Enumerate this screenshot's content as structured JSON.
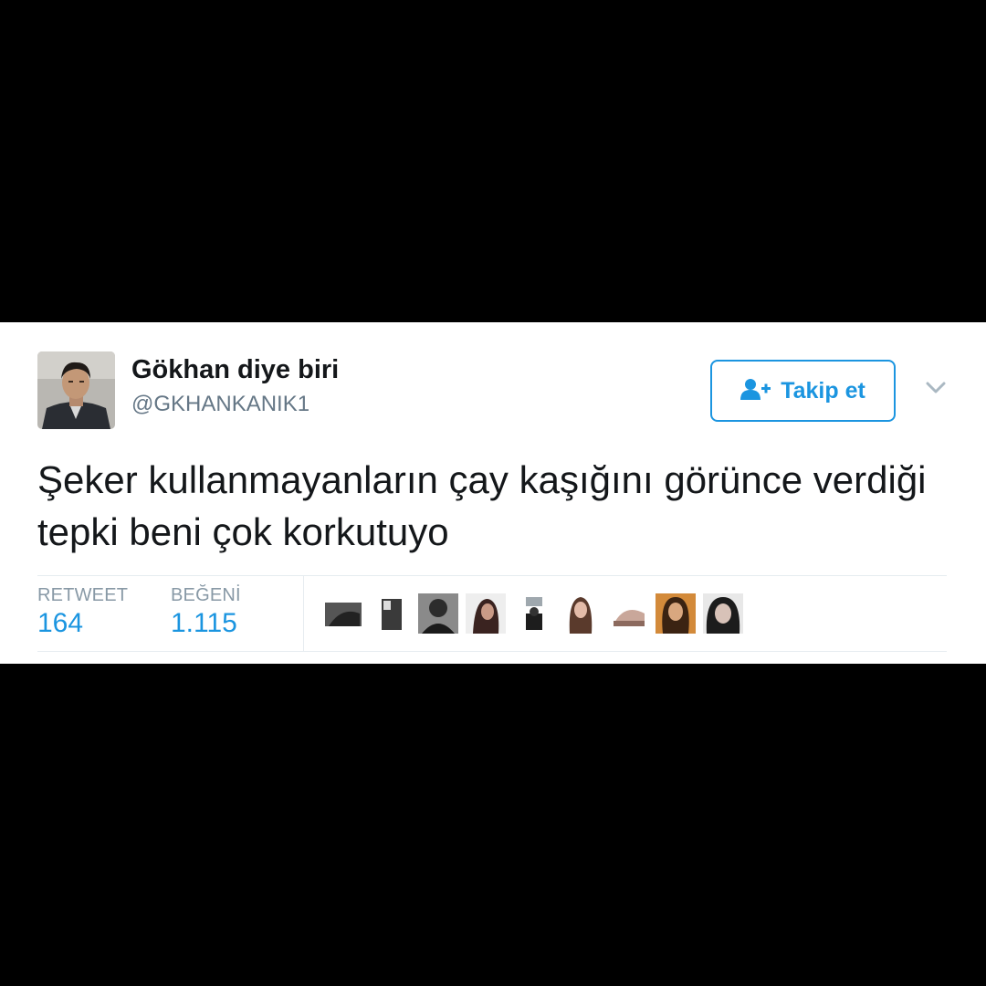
{
  "tweet": {
    "display_name": "Gökhan diye biri",
    "handle": "@GKHANKANIK1",
    "text": "Şeker kullanmayanların çay kaşığını görünce verdiği tepki beni çok korkutuyo"
  },
  "actions": {
    "follow_label": "Takip et",
    "follow_icon": "add-user-icon",
    "menu_icon": "chevron-down-icon"
  },
  "stats": {
    "retweet_label": "RETWEET",
    "retweet_count": "164",
    "like_label": "BEĞENİ",
    "like_count": "1.115"
  },
  "colors": {
    "accent": "#1b95e0",
    "text": "#14171a",
    "muted": "#657786",
    "divider": "#e6ecf0",
    "background_frame": "#000000"
  }
}
